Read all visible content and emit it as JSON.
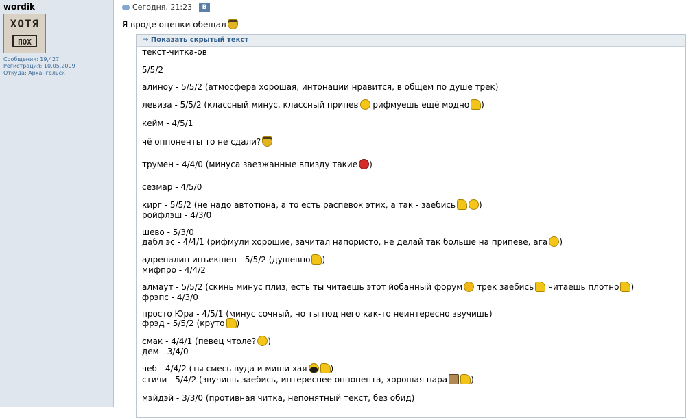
{
  "user": {
    "name": "wordik",
    "avatar_top": "ХОТЯ",
    "avatar_bottom": "ПОХ",
    "posts": "Сообщения: 19,427",
    "registered": "Регистрация: 10.05.2009",
    "location": "Откуда: Архангельск"
  },
  "post": {
    "date": "Сегодня, 21:23",
    "vk_badge": "В",
    "message": "Я вроде оценки обещал",
    "spoiler_label": "Показать скрытый текст"
  },
  "lines": [
    "текст-читка-ов",
    "5/5/2",
    "алиноу - 5/5/2 (атмосфера хорошая, интонации нравится, в общем по душе трек)",
    "левиза - 5/5/2 (классный минус, классный припев",
    " рифмуешь ещё модно",
    "кейм - 4/5/1",
    "чё оппоненты то не сдали?",
    "трумен - 4/4/0 (минуса заезжанные впизду такие",
    "сезмар - 4/5/0",
    "кирг - 5/5/2 (не надо автотюна, а то есть распевок этих, а так - заебись",
    "ройфлэш - 4/3/0",
    "шево - 5/3/0",
    "дабл эс - 4/4/1 (рифмули хорошие, зачитал напористо, не делай так больше на припеве, ага",
    "адреналин инъекшен - 5/5/2 (душевно",
    "мифпро - 4/4/2",
    "алмаут - 5/5/2 (скинь минус плиз, есть ты читаешь этот йобанный форум",
    " трек заебись",
    " читаешь плотно",
    "фрэпс - 4/3/0",
    "просто Юра - 4/5/1 (минус сочный, но ты под него как-то неинтересно звучишь)",
    "фрэд - 5/5/2 (круто",
    "смак - 4/4/1 (певец чтоле?",
    "дем - 3/4/0",
    "чеб - 4/4/2 (ты смесь вуда и миши хая",
    "стичи - 5/4/2 (звучишь заебись, интереснее оппонента, хорошая пара",
    "мэйдэй - 3/3/0 (противная читка, непонятный текст, без обид)"
  ],
  "close_paren": ")",
  "icons": [
    "cloud-icon",
    "thumbs-up-icon",
    "smiley-icon",
    "hat-smiley-icon",
    "red-face-icon",
    "sad-icon",
    "long-hair-icon",
    "box-icon"
  ]
}
